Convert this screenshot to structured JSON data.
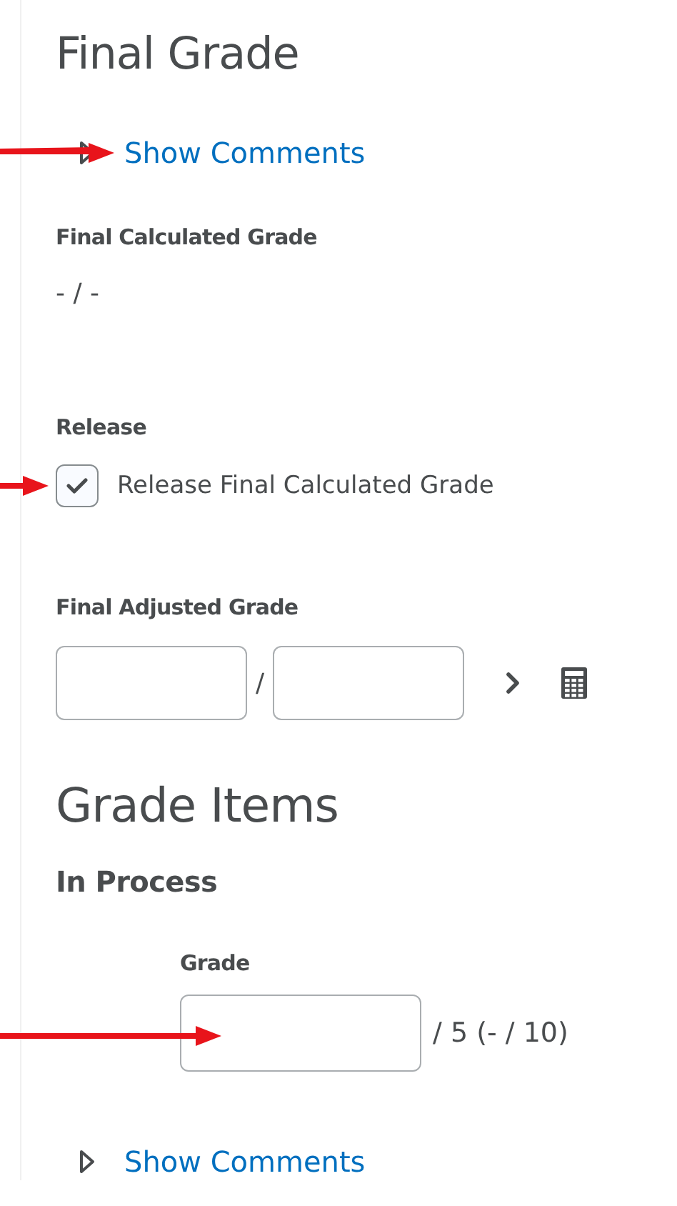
{
  "final_grade": {
    "title": "Final Grade",
    "show_comments": {
      "label": "Show Comments",
      "expanded": false
    },
    "calculated": {
      "label": "Final Calculated Grade",
      "value": "- / -"
    },
    "release": {
      "label": "Release",
      "checkbox_label": "Release Final Calculated Grade",
      "checked": true
    },
    "adjusted": {
      "label": "Final Adjusted Grade",
      "separator": "/"
    }
  },
  "grade_items": {
    "title": "Grade Items",
    "section": "In Process",
    "grade_label": "Grade",
    "out_of": "/ 5 (- / 10)",
    "show_comments": {
      "label": "Show Comments",
      "expanded": false
    }
  }
}
